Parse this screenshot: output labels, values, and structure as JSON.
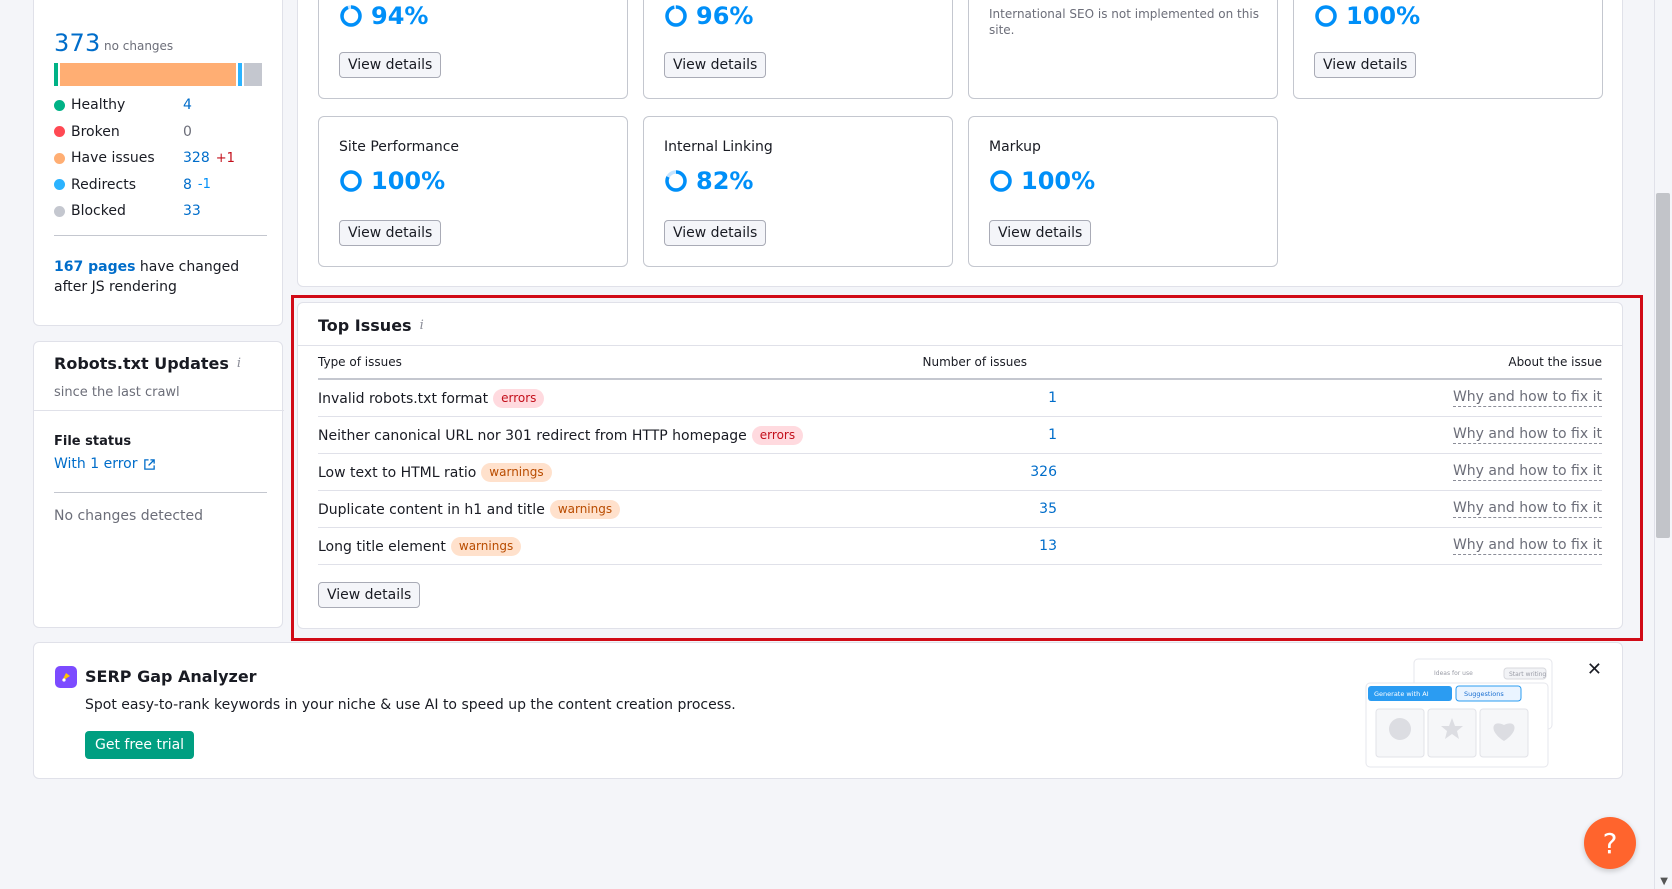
{
  "crawled": {
    "total": "373",
    "total_note": "no changes",
    "bar_fractions": [
      {
        "name": "Healthy",
        "value": 4,
        "color": "#00b286"
      },
      {
        "name": "Have issues",
        "value": 328,
        "color": "#ffae73"
      },
      {
        "name": "Redirects",
        "value": 8,
        "color": "#2bb3ff"
      },
      {
        "name": "Blocked",
        "value": 33,
        "color": "#c4c7cf"
      }
    ],
    "statuses": [
      {
        "label": "Healthy",
        "value": "4",
        "delta": "",
        "color": "#00b286"
      },
      {
        "label": "Broken",
        "value": "0",
        "delta": "",
        "color": "#ff4953"
      },
      {
        "label": "Have issues",
        "value": "328",
        "delta": "+1",
        "color": "#ffae73"
      },
      {
        "label": "Redirects",
        "value": "8",
        "delta": "-1",
        "color": "#2bb3ff"
      },
      {
        "label": "Blocked",
        "value": "33",
        "delta": "",
        "color": "#c4c7cf"
      }
    ],
    "js_pages_link": "167 pages",
    "js_pages_text": " have changed after JS rendering"
  },
  "robots": {
    "title": "Robots.txt Updates",
    "info": "i",
    "subtitle": "since the last crawl",
    "file_status_label": "File status",
    "file_status_link": "With 1 error",
    "no_changes": "No changes detected"
  },
  "thematic": {
    "tiles": [
      {
        "score": "94%",
        "score_value": 94,
        "button": "View details"
      },
      {
        "score": "96%",
        "score_value": 96,
        "button": "View details"
      },
      {
        "note": "International SEO is not implemented on this site."
      },
      {
        "score": "100%",
        "score_value": 100,
        "button": "View details"
      },
      {
        "title": "Site Performance",
        "score": "100%",
        "score_value": 100,
        "button": "View details"
      },
      {
        "title": "Internal Linking",
        "score": "82%",
        "score_value": 82,
        "button": "View details"
      },
      {
        "title": "Markup",
        "score": "100%",
        "score_value": 100,
        "button": "View details"
      }
    ]
  },
  "top_issues": {
    "title": "Top Issues",
    "info": "i",
    "columns": [
      "Type of issues",
      "Number of issues",
      "About the issue"
    ],
    "rows": [
      {
        "name": "Invalid robots.txt format",
        "badge": "errors",
        "count": "1",
        "link": "Why and how to fix it"
      },
      {
        "name": "Neither canonical URL nor 301 redirect from HTTP homepage",
        "badge": "errors",
        "count": "1",
        "link": "Why and how to fix it"
      },
      {
        "name": "Low text to HTML ratio",
        "badge": "warnings",
        "count": "326",
        "link": "Why and how to fix it"
      },
      {
        "name": "Duplicate content in h1 and title",
        "badge": "warnings",
        "count": "35",
        "link": "Why and how to fix it"
      },
      {
        "name": "Long title element",
        "badge": "warnings",
        "count": "13",
        "link": "Why and how to fix it"
      }
    ],
    "button": "View details"
  },
  "serp": {
    "title": "SERP Gap Analyzer",
    "description": "Spot easy-to-rank keywords in your niche & use AI to speed up the content creation process.",
    "cta": "Get free trial",
    "close": "✕",
    "illus_ideas": "Ideas for use",
    "illus_start": "Start writing",
    "illus_generate": "Generate with AI",
    "illus_suggestions": "Suggestions"
  },
  "help": {
    "label": "?"
  },
  "colors": {
    "accent": "#008ff8",
    "link": "#006dca",
    "highlight": "#d10b17",
    "cta": "#009f81",
    "help": "#ff642d"
  }
}
